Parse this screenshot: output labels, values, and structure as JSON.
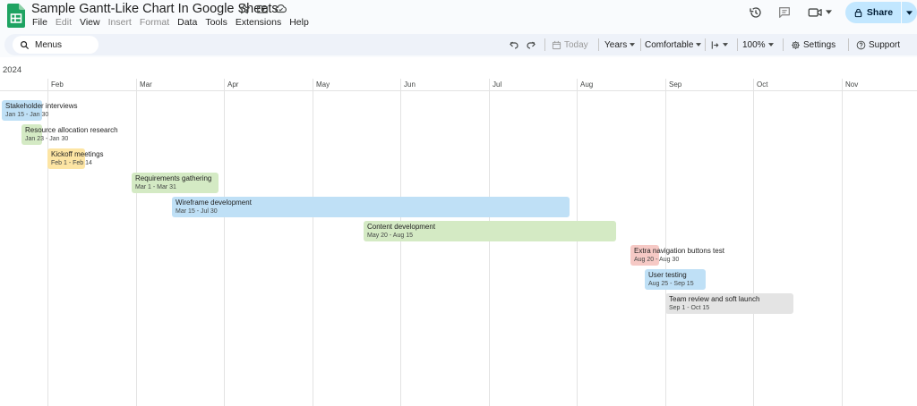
{
  "window": {
    "title": "Sample Gantt-Like Chart In Google Sheets"
  },
  "menu": [
    {
      "label": "File",
      "enabled": true
    },
    {
      "label": "Edit",
      "enabled": false
    },
    {
      "label": "View",
      "enabled": true
    },
    {
      "label": "Insert",
      "enabled": false
    },
    {
      "label": "Format",
      "enabled": false
    },
    {
      "label": "Data",
      "enabled": true
    },
    {
      "label": "Tools",
      "enabled": true
    },
    {
      "label": "Extensions",
      "enabled": true
    },
    {
      "label": "Help",
      "enabled": true
    }
  ],
  "share": {
    "label": "Share"
  },
  "toolbar": {
    "search_label": "Menus",
    "today_label": "Today",
    "scale_label": "Years",
    "density_label": "Comfortable",
    "zoom_label": "100%",
    "settings_label": "Settings",
    "support_label": "Support"
  },
  "colors": {
    "accent": "#0b57d0",
    "share_bg": "#c2e7ff",
    "blue": "#bfe0f6",
    "green": "#d4eac4",
    "yellow": "#fde5a4",
    "red": "#f6c9c5",
    "grey": "#e4e4e4"
  },
  "timeline": {
    "year": "2024",
    "months": [
      "Feb",
      "Mar",
      "Apr",
      "May",
      "Jun",
      "Jul",
      "Aug",
      "Sep",
      "Oct",
      "Nov"
    ],
    "tasks": [
      {
        "name": "Stakeholder interviews",
        "dates": "Jan 15 - Jan 30",
        "start": "2024-01-15",
        "end": "2024-01-30",
        "color": "blue"
      },
      {
        "name": "Resource allocation research",
        "dates": "Jan 23 - Jan 30",
        "start": "2024-01-23",
        "end": "2024-01-30",
        "color": "green"
      },
      {
        "name": "Kickoff meetings",
        "dates": "Feb 1 - Feb 14",
        "start": "2024-02-01",
        "end": "2024-02-14",
        "color": "yellow"
      },
      {
        "name": "Requirements gathering",
        "dates": "Mar 1 - Mar 31",
        "start": "2024-03-01",
        "end": "2024-03-31",
        "color": "green"
      },
      {
        "name": "Wireframe development",
        "dates": "Mar 15 - Jul 30",
        "start": "2024-03-15",
        "end": "2024-07-30",
        "color": "blue"
      },
      {
        "name": "Content development",
        "dates": "May 20 - Aug 15",
        "start": "2024-05-20",
        "end": "2024-08-15",
        "color": "green"
      },
      {
        "name": "Extra navigation buttons test",
        "dates": "Aug 20 - Aug 30",
        "start": "2024-08-20",
        "end": "2024-08-30",
        "color": "red"
      },
      {
        "name": "User testing",
        "dates": "Aug 25 - Sep 15",
        "start": "2024-08-25",
        "end": "2024-09-15",
        "color": "blue"
      },
      {
        "name": "Team review and soft launch",
        "dates": "Sep 1 - Oct 15",
        "start": "2024-09-01",
        "end": "2024-10-15",
        "color": "grey"
      }
    ]
  }
}
